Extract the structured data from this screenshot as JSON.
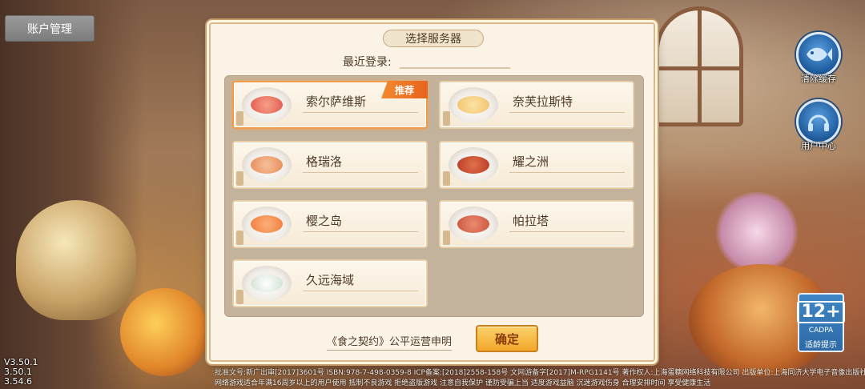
{
  "account": {
    "label": "账户管理"
  },
  "right_buttons": {
    "clear_cache": {
      "label": "清除缓存",
      "icon": "fish-icon"
    },
    "user_center": {
      "label": "用户中心",
      "icon": "headphones-icon"
    }
  },
  "age_rating": {
    "number": "12+",
    "org": "CADPA",
    "text": "适龄提示"
  },
  "version": [
    "V3.50.1",
    "3.50.1",
    "3.54.6"
  ],
  "dialog": {
    "title": "选择服务器",
    "recent_label": "最近登录:",
    "recent_value": "",
    "servers": [
      {
        "name": "索尔萨维斯",
        "badge": "推荐",
        "selected": true,
        "dish_color": "#e0584a"
      },
      {
        "name": "奈芙拉斯特",
        "badge": "",
        "selected": false,
        "dish_color": "#f1c26a"
      },
      {
        "name": "格瑞洛",
        "badge": "",
        "selected": false,
        "dish_color": "#e68a55"
      },
      {
        "name": "耀之洲",
        "badge": "",
        "selected": false,
        "dish_color": "#b83a26"
      },
      {
        "name": "樱之岛",
        "badge": "",
        "selected": false,
        "dish_color": "#f07b3a"
      },
      {
        "name": "帕拉塔",
        "badge": "",
        "selected": false,
        "dish_color": "#c9553c"
      },
      {
        "name": "久远海域",
        "badge": "",
        "selected": false,
        "dish_color": "#e9eef2"
      }
    ],
    "statement": "《食之契约》公平运营申明",
    "confirm": "确定"
  },
  "legal_text": {
    "line1": "批准文号:新广出审[2017]3601号 ISBN:978-7-498-0359-8 ICP备案:[2018]2558-158号 文网游备字[2017]M-RPG1141号 著作权人:上海蛋糖网络科技有限公司 出版单位:上海同济大学电子音像出版社有限公司",
    "line2": "网络游戏适合年满16周岁以上的用户使用 抵制不良游戏 拒绝盗版游戏 注意自我保护 谨防受骗上当 适度游戏益脑 沉迷游戏伤身 合理安排时间 享受健康生活"
  }
}
